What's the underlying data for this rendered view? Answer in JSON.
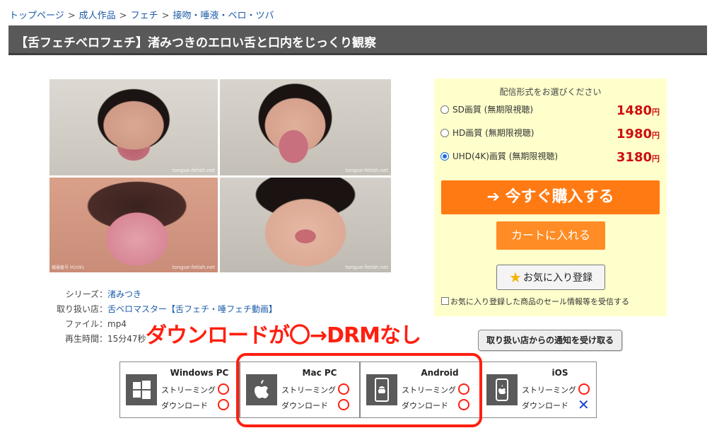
{
  "breadcrumb": [
    "トップページ",
    "成人作品",
    "フェチ",
    "接吻・唾液・ベロ・ツバ"
  ],
  "title": "【舌フェチベロフェチ】渚みつきのエロい舌と口内をじっくり観察",
  "gallery": {
    "watermark": "tongue-fetish.net",
    "code": "織撮番号 M2081"
  },
  "info": [
    {
      "key": "シリーズ",
      "value": "渚みつき",
      "link": true
    },
    {
      "key": "取り扱い店",
      "value": "舌ベロマスター【舌フェチ・唾フェチ動画】",
      "link": true
    },
    {
      "key": "ファイル",
      "value": "mp4",
      "link": false
    },
    {
      "key": "再生時間",
      "value": "15分47秒",
      "link": false
    }
  ],
  "overlay_text": "ダウンロードが〇→DRMなし",
  "notify_button": "取り扱い店からの通知を受け取る",
  "purchase": {
    "heading": "配信形式をお選びください",
    "options": [
      {
        "label": "SD画質 (無期限視聴)",
        "price": "1480",
        "unit": "円",
        "selected": false
      },
      {
        "label": "HD画質 (無期限視聴)",
        "price": "1980",
        "unit": "円",
        "selected": false
      },
      {
        "label": "UHD(4K)画質 (無期限視聴)",
        "price": "3180",
        "unit": "円",
        "selected": true
      }
    ],
    "buy_now": "➔ 今すぐ購入する",
    "add_to_cart": "カートに入れる",
    "favorite": "お気に入り登録",
    "sale_notice": "お気に入り登録した商品のセール情報等を受信する"
  },
  "platforms": [
    {
      "name": "Windows PC",
      "icon": "windows-icon",
      "streaming": "ok",
      "download": "ok"
    },
    {
      "name": "Mac PC",
      "icon": "apple-icon",
      "streaming": "ok",
      "download": "ok"
    },
    {
      "name": "Android",
      "icon": "android-icon",
      "streaming": "ok",
      "download": "ok"
    },
    {
      "name": "iOS",
      "icon": "ios-icon",
      "streaming": "ok",
      "download": "ng"
    }
  ],
  "platform_labels": {
    "streaming": "ストリーミング",
    "download": "ダウンロード"
  },
  "colors": {
    "accent": "#ff7a12",
    "price": "#cc1010",
    "highlight": "#ff1f10",
    "link": "#1a5aa8"
  }
}
